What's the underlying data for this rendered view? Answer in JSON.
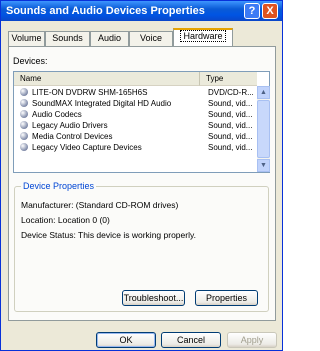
{
  "title": "Sounds and Audio Devices Properties",
  "title_buttons": {
    "help": "?",
    "close": "X"
  },
  "tabs": [
    "Volume",
    "Sounds",
    "Audio",
    "Voice",
    "Hardware"
  ],
  "active_tab": "Hardware",
  "devices_label": "Devices:",
  "columns": {
    "name": "Name",
    "type": "Type"
  },
  "devices": [
    {
      "name": "LITE-ON DVDRW SHM-165H6S",
      "type": "DVD/CD-R...",
      "selected": true
    },
    {
      "name": "SoundMAX Integrated Digital HD Audio",
      "type": "Sound, vid..."
    },
    {
      "name": "Audio Codecs",
      "type": "Sound, vid..."
    },
    {
      "name": "Legacy Audio Drivers",
      "type": "Sound, vid..."
    },
    {
      "name": "Media Control Devices",
      "type": "Sound, vid..."
    },
    {
      "name": "Legacy Video Capture Devices",
      "type": "Sound, vid..."
    }
  ],
  "device_properties": {
    "title": "Device Properties",
    "manufacturer": "Manufacturer: (Standard CD-ROM drives)",
    "location": "Location: Location 0 (0)",
    "status": "Device Status: This device is working properly."
  },
  "buttons": {
    "troubleshoot": "Troubleshoot...",
    "properties": "Properties",
    "ok": "OK",
    "cancel": "Cancel",
    "apply": "Apply"
  },
  "colors": {
    "title_bar": "#0054e3",
    "group_title": "#0046d5",
    "active_tab_accent": "#e6a300"
  }
}
